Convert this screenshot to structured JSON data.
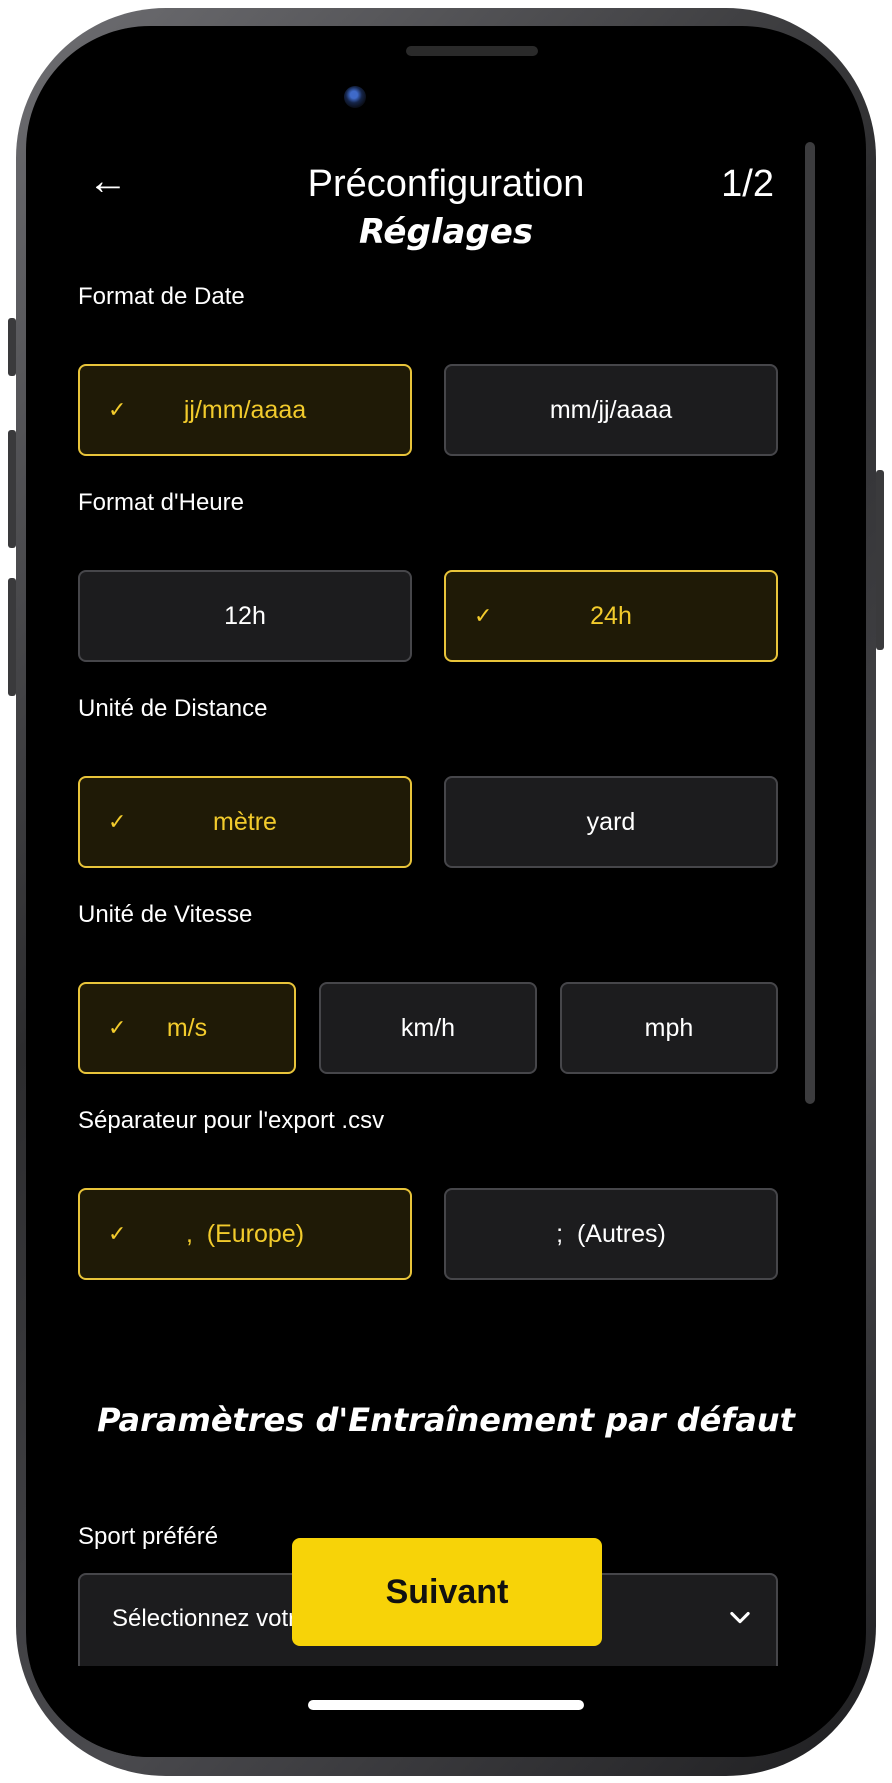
{
  "header": {
    "back_icon": "←",
    "title": "Préconfiguration",
    "step": "1/2"
  },
  "settings": {
    "title": "Réglages",
    "date_format": {
      "label": "Format de Date",
      "options": [
        {
          "label": "jj/mm/aaaa",
          "selected": true
        },
        {
          "label": "mm/jj/aaaa",
          "selected": false
        }
      ]
    },
    "time_format": {
      "label": "Format d'Heure",
      "options": [
        {
          "label": "12h",
          "selected": false
        },
        {
          "label": "24h",
          "selected": true
        }
      ]
    },
    "distance_unit": {
      "label": "Unité de Distance",
      "options": [
        {
          "label": "mètre",
          "selected": true
        },
        {
          "label": "yard",
          "selected": false
        }
      ]
    },
    "speed_unit": {
      "label": "Unité de Vitesse",
      "options": [
        {
          "label": "m/s",
          "selected": true
        },
        {
          "label": "km/h",
          "selected": false
        },
        {
          "label": "mph",
          "selected": false
        }
      ]
    },
    "csv_separator": {
      "label": "Séparateur pour l'export .csv",
      "options": [
        {
          "label": ",  (Europe)",
          "selected": true
        },
        {
          "label": ";  (Autres)",
          "selected": false
        }
      ]
    }
  },
  "training": {
    "title": "Paramètres d'Entraînement par défaut",
    "sport": {
      "label": "Sport préféré",
      "placeholder": "Sélectionnez votr"
    }
  },
  "check_icon": "✓",
  "next_button": "Suivant",
  "colors": {
    "accent": "#f7d308",
    "selected_border": "#e8c43a",
    "selected_text": "#f2cb2c",
    "background": "#000000",
    "option_bg": "#1c1c1e"
  }
}
